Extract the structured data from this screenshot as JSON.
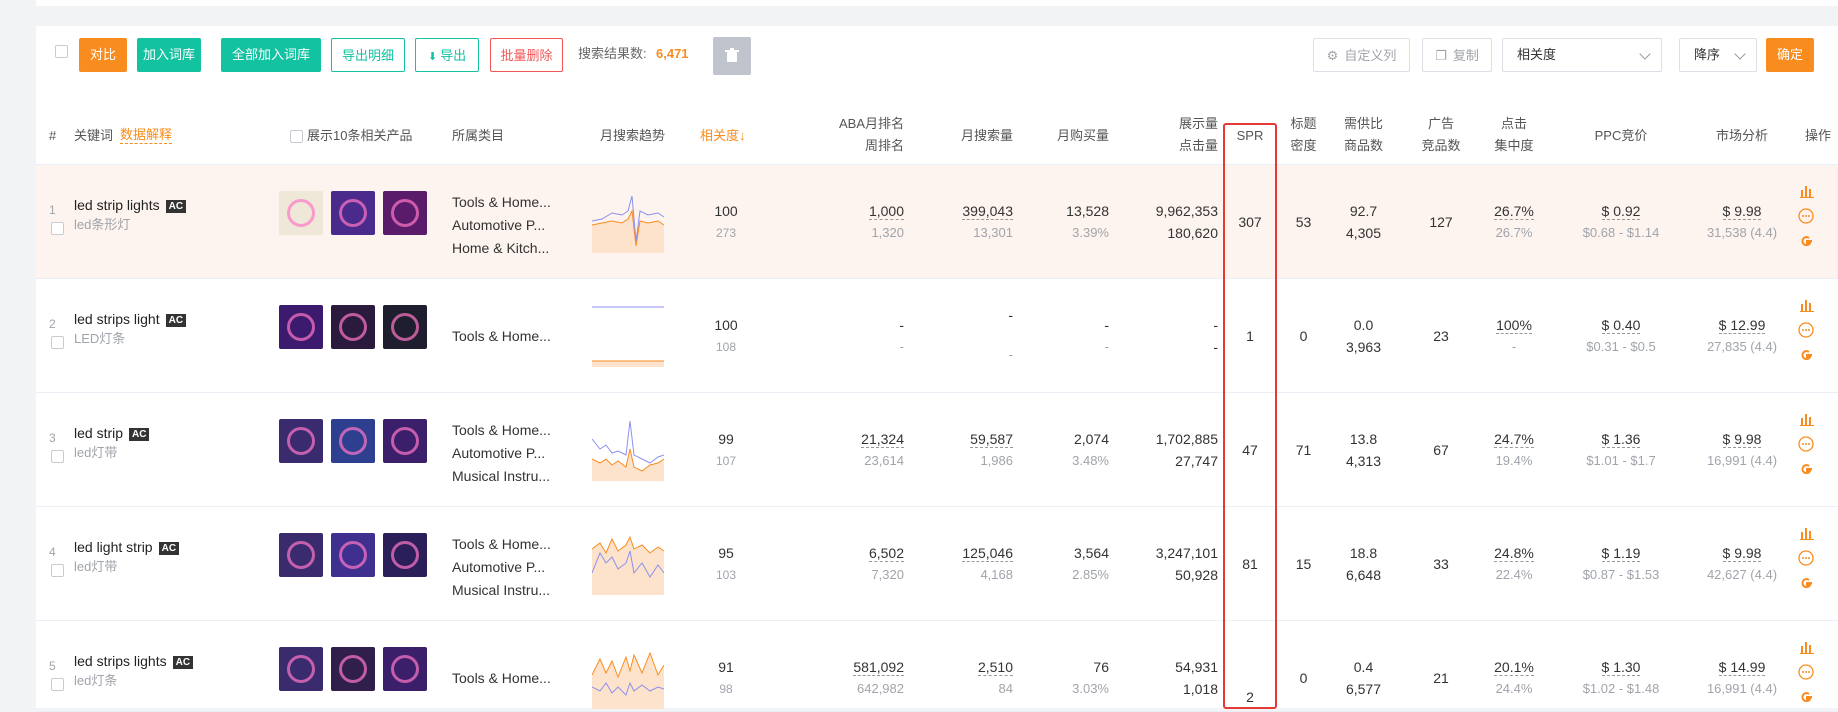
{
  "toolbar": {
    "compare": "对比",
    "add_to_lib": "加入词库",
    "add_all_to_lib": "全部加入词库",
    "export_detail": "导出明细",
    "export": "导出",
    "batch_delete": "批量删除",
    "result_label": "搜索结果数:",
    "result_count": "6,471",
    "custom_columns": "自定义列",
    "copy": "复制",
    "sort_field": "相关度",
    "sort_order": "降序",
    "confirm": "确定"
  },
  "columns": {
    "index": "#",
    "keyword": "关键词",
    "data_explain": "数据解释",
    "show_products": "展示10条相关产品",
    "category": "所属类目",
    "trend": "月搜索趋势",
    "relevance": "相关度↓",
    "aba_month": "ABA月排名",
    "aba_week": "周排名",
    "monthly_search": "月搜索量",
    "monthly_purchase": "月购买量",
    "impressions": "展示量",
    "clicks": "点击量",
    "spr": "SPR",
    "title_density_1": "标题",
    "title_density_2": "密度",
    "supply_ratio_1": "需供比",
    "supply_ratio_2": "商品数",
    "ad_products_1": "广告",
    "ad_products_2": "竞品数",
    "click_conc_1": "点击",
    "click_conc_2": "集中度",
    "ppc": "PPC竞价",
    "market": "市场分析",
    "action": "操作"
  },
  "rows": [
    {
      "index": "1",
      "keyword": "led strip lights",
      "badge": "AC",
      "translation": "led条形灯",
      "categories": [
        "Tools & Home...",
        "Automotive P...",
        "Home & Kitch..."
      ],
      "relevance": "100",
      "relevance_sub": "273",
      "aba_month": "1,000",
      "aba_week": "1,320",
      "search": "399,043",
      "search_sub": "13,301",
      "purchase": "13,528",
      "purchase_rate": "3.39%",
      "impressions": "9,962,353",
      "clicks": "180,620",
      "spr": "307",
      "title_density": "53",
      "supply_ratio": "92.7",
      "products": "4,305",
      "ad_products": "127",
      "click_conc": "26.7%",
      "click_conc_sub": "26.7%",
      "ppc": "$ 0.92",
      "ppc_range": "$0.68 - $1.14",
      "market_price": "$ 9.98",
      "market_sub": "31,538 (4.4)"
    },
    {
      "index": "2",
      "keyword": "led strips light",
      "badge": "AC",
      "translation": "LED灯条",
      "categories": [
        "Tools & Home..."
      ],
      "relevance": "100",
      "relevance_sub": "108",
      "aba_month": "-",
      "aba_week": "-",
      "search": "-",
      "search_sub": "-",
      "purchase": "-",
      "purchase_rate": "-",
      "impressions": "-",
      "clicks": "-",
      "spr": "1",
      "title_density": "0",
      "supply_ratio": "0.0",
      "products": "3,963",
      "ad_products": "23",
      "click_conc": "100%",
      "click_conc_sub": "-",
      "ppc": "$ 0.40",
      "ppc_range": "$0.31 - $0.5",
      "market_price": "$ 12.99",
      "market_sub": "27,835 (4.4)"
    },
    {
      "index": "3",
      "keyword": "led strip",
      "badge": "AC",
      "translation": "led灯带",
      "categories": [
        "Tools & Home...",
        "Automotive P...",
        "Musical Instru..."
      ],
      "relevance": "99",
      "relevance_sub": "107",
      "aba_month": "21,324",
      "aba_week": "23,614",
      "search": "59,587",
      "search_sub": "1,986",
      "purchase": "2,074",
      "purchase_rate": "3.48%",
      "impressions": "1,702,885",
      "clicks": "27,747",
      "spr": "47",
      "title_density": "71",
      "supply_ratio": "13.8",
      "products": "4,313",
      "ad_products": "67",
      "click_conc": "24.7%",
      "click_conc_sub": "19.4%",
      "ppc": "$ 1.36",
      "ppc_range": "$1.01 - $1.7",
      "market_price": "$ 9.98",
      "market_sub": "16,991 (4.4)"
    },
    {
      "index": "4",
      "keyword": "led light strip",
      "badge": "AC",
      "translation": "led灯带",
      "categories": [
        "Tools & Home...",
        "Automotive P...",
        "Musical Instru..."
      ],
      "relevance": "95",
      "relevance_sub": "103",
      "aba_month": "6,502",
      "aba_week": "7,320",
      "search": "125,046",
      "search_sub": "4,168",
      "purchase": "3,564",
      "purchase_rate": "2.85%",
      "impressions": "3,247,101",
      "clicks": "50,928",
      "spr": "81",
      "title_density": "15",
      "supply_ratio": "18.8",
      "products": "6,648",
      "ad_products": "33",
      "click_conc": "24.8%",
      "click_conc_sub": "22.4%",
      "ppc": "$ 1.19",
      "ppc_range": "$0.87 - $1.53",
      "market_price": "$ 9.98",
      "market_sub": "42,627 (4.4)"
    },
    {
      "index": "5",
      "keyword": "led strips lights",
      "badge": "AC",
      "translation": "led灯条",
      "categories": [
        "Tools & Home..."
      ],
      "relevance": "91",
      "relevance_sub": "98",
      "aba_month": "581,092",
      "aba_week": "642,982",
      "search": "2,510",
      "search_sub": "84",
      "purchase": "76",
      "purchase_rate": "3.03%",
      "impressions": "54,931",
      "clicks": "1,018",
      "spr": "2",
      "title_density": "0",
      "supply_ratio": "0.4",
      "products": "6,577",
      "ad_products": "21",
      "click_conc": "20.1%",
      "click_conc_sub": "24.4%",
      "ppc": "$ 1.30",
      "ppc_range": "$1.02 - $1.48",
      "market_price": "$ 14.99",
      "market_sub": "16,991 (4.4)"
    }
  ],
  "colors": {
    "orange": "#f98c1f",
    "green": "#12c2a0",
    "red_outline": "#e53935",
    "highlight_row": "#fdf3ef"
  }
}
